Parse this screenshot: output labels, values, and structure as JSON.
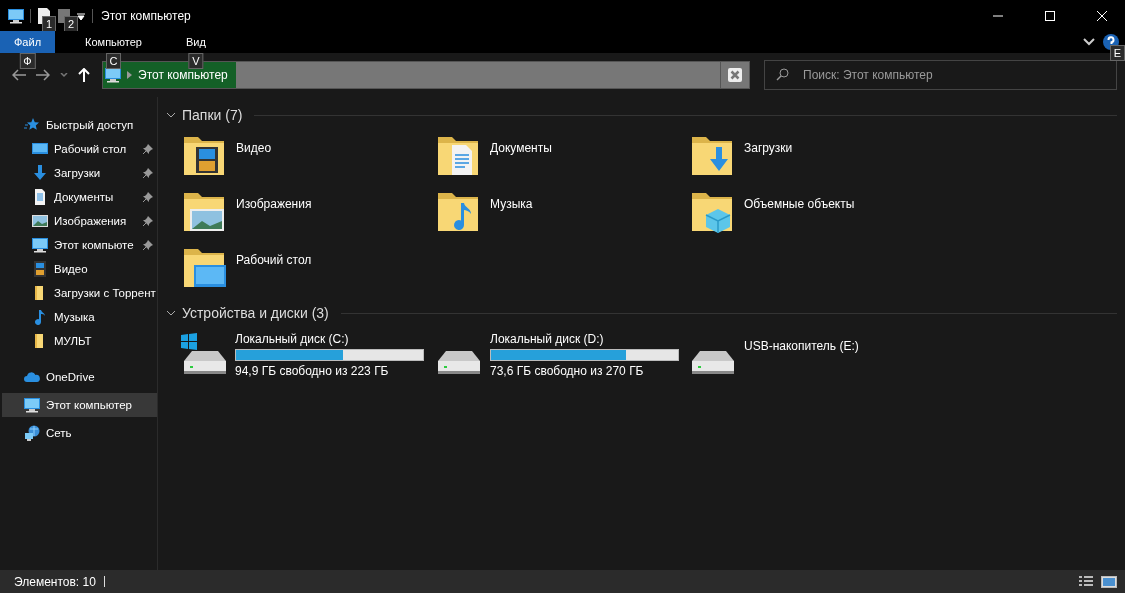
{
  "window": {
    "title": "Этот компьютер"
  },
  "quick_access": {
    "keytips": [
      "1",
      "2"
    ]
  },
  "ribbon": {
    "tabs": [
      {
        "label": "Файл",
        "selected": true,
        "keytip": "Ф"
      },
      {
        "label": "Компьютер",
        "selected": false,
        "keytip": "C"
      },
      {
        "label": "Вид",
        "selected": false,
        "keytip": "V"
      }
    ],
    "help_keytip": "E"
  },
  "address_bar": {
    "path": "Этот компьютер"
  },
  "search": {
    "placeholder": "Поиск: Этот компьютер"
  },
  "sidebar": {
    "sections": [
      {
        "label": "Быстрый доступ",
        "kind": "star",
        "selected": false,
        "children": [
          {
            "label": "Рабочий стол",
            "kind": "desktop",
            "pinned": true
          },
          {
            "label": "Загрузки",
            "kind": "download",
            "pinned": true
          },
          {
            "label": "Документы",
            "kind": "document",
            "pinned": true
          },
          {
            "label": "Изображения",
            "kind": "image",
            "pinned": true
          },
          {
            "label": "Этот компьюте",
            "kind": "computer",
            "pinned": true
          },
          {
            "label": "Видео",
            "kind": "video",
            "pinned": false
          },
          {
            "label": "Загрузки с Торрент",
            "kind": "folder",
            "pinned": false
          },
          {
            "label": "Музыка",
            "kind": "music",
            "pinned": false
          },
          {
            "label": "МУЛЬТ",
            "kind": "folder",
            "pinned": false
          }
        ]
      },
      {
        "label": "OneDrive",
        "kind": "cloud",
        "selected": false
      },
      {
        "label": "Этот компьютер",
        "kind": "computer",
        "selected": true
      },
      {
        "label": "Сеть",
        "kind": "network",
        "selected": false
      }
    ]
  },
  "folders": {
    "title": "Папки (7)",
    "items": [
      {
        "name": "Видео",
        "kind": "video"
      },
      {
        "name": "Документы",
        "kind": "document"
      },
      {
        "name": "Загрузки",
        "kind": "download"
      },
      {
        "name": "Изображения",
        "kind": "image"
      },
      {
        "name": "Музыка",
        "kind": "music"
      },
      {
        "name": "Объемные объекты",
        "kind": "cube"
      },
      {
        "name": "Рабочий стол",
        "kind": "desktop"
      }
    ]
  },
  "drives": {
    "title": "Устройства и диски (3)",
    "items": [
      {
        "name": "Локальный диск (C:)",
        "kind": "system",
        "level": 0.57,
        "free": "94,9 ГБ свободно из 223 ГБ"
      },
      {
        "name": "Локальный диск (D:)",
        "kind": "disk",
        "level": 0.72,
        "free": "73,6 ГБ свободно из 270 ГБ"
      },
      {
        "name": "USB-накопитель (E:)",
        "kind": "usb"
      }
    ]
  },
  "status_bar": {
    "text": "Элементов: 10"
  }
}
